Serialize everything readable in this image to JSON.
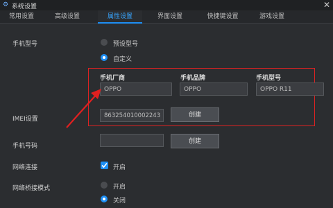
{
  "window": {
    "title": "系统设置",
    "close_symbol": "✕"
  },
  "tabs": [
    {
      "label": "常用设置",
      "active": false
    },
    {
      "label": "高级设置",
      "active": false
    },
    {
      "label": "属性设置",
      "active": true
    },
    {
      "label": "界面设置",
      "active": false
    },
    {
      "label": "快捷键设置",
      "active": false
    },
    {
      "label": "游戏设置",
      "active": false
    }
  ],
  "phone_model": {
    "label": "手机型号",
    "option_preset": "预设型号",
    "option_custom": "自定义",
    "selected": "custom"
  },
  "custom": {
    "manufacturer_label": "手机厂商",
    "manufacturer_value": "OPPO",
    "brand_label": "手机品牌",
    "brand_value": "OPPO",
    "model_label": "手机型号",
    "model_value": "OPPO R11"
  },
  "imei": {
    "label": "IMEI设置",
    "value": "863254010002243",
    "button": "创建"
  },
  "phone_number": {
    "label": "手机号码",
    "value": "",
    "button": "创建"
  },
  "network": {
    "label": "网络连接",
    "checkbox_label": "开启",
    "checked": true
  },
  "bridge": {
    "label": "网络桥接模式",
    "option_on": "开启",
    "option_off": "关闭",
    "selected": "off"
  },
  "colors": {
    "accent": "#1e8ff5",
    "highlight_box": "#dd2222",
    "background": "#2b2d30"
  }
}
